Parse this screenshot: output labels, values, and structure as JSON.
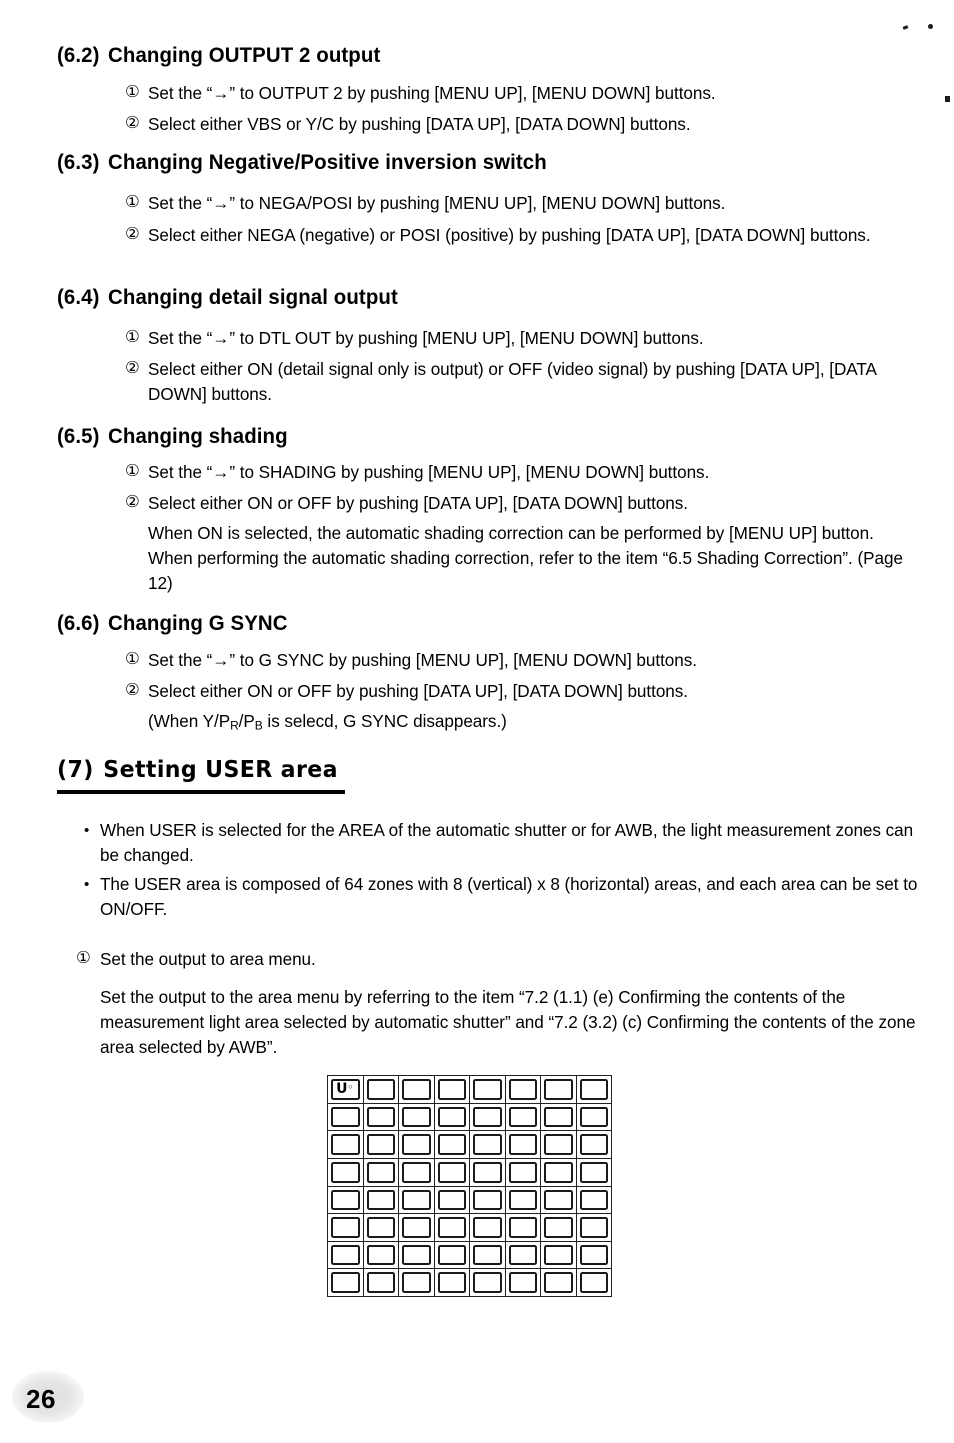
{
  "page": {
    "number": "26"
  },
  "sections": [
    {
      "id": "6.2",
      "number": "(6.2)",
      "title": "Changing OUTPUT 2 output",
      "steps": [
        {
          "marker": "①",
          "text": "Set the “→” to OUTPUT 2 by pushing [MENU UP], [MENU DOWN] buttons."
        },
        {
          "marker": "②",
          "text": "Select either VBS or Y/C by pushing [DATA UP], [DATA DOWN] buttons."
        }
      ]
    },
    {
      "id": "6.3",
      "number": "(6.3)",
      "title": "Changing Negative/Positive inversion switch",
      "steps": [
        {
          "marker": "①",
          "text": "Set the “→” to NEGA/POSI by pushing [MENU UP], [MENU DOWN] buttons."
        },
        {
          "marker": "②",
          "text": "Select either NEGA (negative) or POSI (positive) by pushing [DATA UP], [DATA DOWN] buttons."
        }
      ]
    },
    {
      "id": "6.4",
      "number": "(6.4)",
      "title": "Changing detail signal output",
      "steps": [
        {
          "marker": "①",
          "text": "Set the “→” to DTL OUT by pushing [MENU UP], [MENU DOWN] buttons."
        },
        {
          "marker": "②",
          "text": "Select either ON (detail signal only is output) or OFF (video signal) by pushing [DATA UP], [DATA DOWN] buttons."
        }
      ]
    },
    {
      "id": "6.5",
      "number": "(6.5)",
      "title": "Changing shading",
      "steps": [
        {
          "marker": "①",
          "text": "Set the “→” to SHADING by pushing [MENU UP], [MENU DOWN] buttons."
        },
        {
          "marker": "②",
          "text": "Select either ON or OFF by pushing [DATA UP], [DATA DOWN] buttons."
        }
      ],
      "note": "When ON is selected, the automatic shading correction can be performed by [MENU UP] button. When performing the automatic shading correction, refer to the item “6.5  Shading Correction”. (Page 12)"
    },
    {
      "id": "6.6",
      "number": "(6.6)",
      "title": "Changing G SYNC",
      "steps": [
        {
          "marker": "①",
          "text": "Set the “→” to G SYNC by pushing [MENU UP], [MENU DOWN] buttons."
        },
        {
          "marker": "②",
          "text": "Select either ON or OFF by pushing [DATA UP], [DATA DOWN] buttons."
        }
      ],
      "note_prefix": "(When Y/P",
      "note_sub1": "R",
      "note_mid": "/P",
      "note_sub2": "B",
      "note_suffix": " is selecd, G SYNC disappears.)"
    }
  ],
  "section7": {
    "number": "(7)",
    "title": "Setting USER area",
    "bullets": [
      {
        "marker": "•",
        "text": "When USER is selected for the AREA of the automatic shutter or for AWB, the light measurement zones can be changed."
      },
      {
        "marker": "•",
        "text": "The USER area is composed of 64 zones with 8 (vertical) x 8 (horizontal) areas, and each area can be set to ON/OFF."
      }
    ],
    "step": {
      "marker": "①",
      "text": "Set the output to area menu."
    },
    "step_body": "Set the output to the area menu by referring to the item “7.2 (1.1) (e) Confirming the contents of the measurement light area selected by automatic shutter” and “7.2 (3.2) (c)  Confirming the contents of the zone area selected by AWB”."
  },
  "user_area_grid": {
    "rows": 8,
    "columns": 8,
    "total_zones": 64,
    "cursor_cell": {
      "row": 1,
      "column": 1,
      "glyph": "U",
      "ring": "◦"
    }
  }
}
